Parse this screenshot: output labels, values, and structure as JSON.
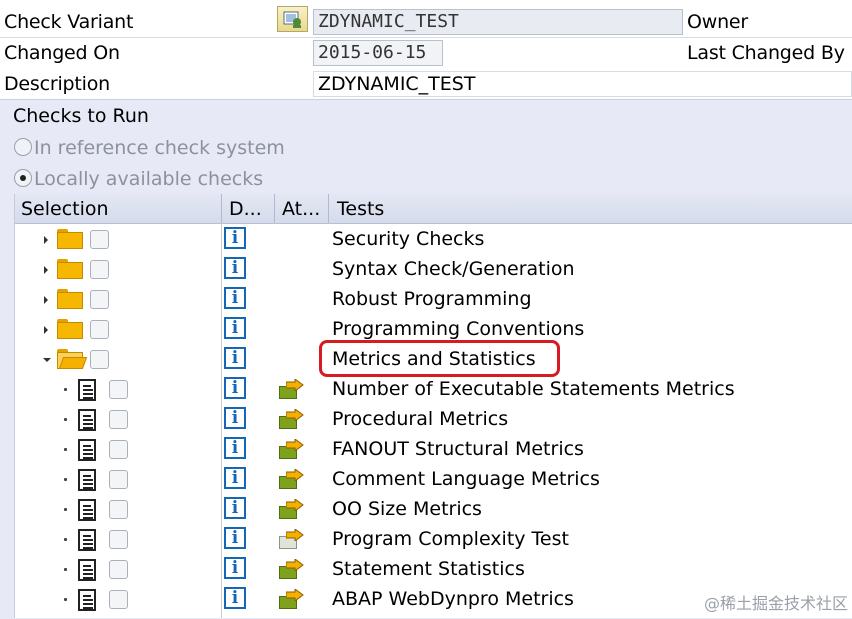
{
  "header": {
    "check_variant_label": "Check Variant",
    "check_variant_value": "ZDYNAMIC_TEST",
    "owner_label": "Owner",
    "changed_on_label": "Changed On",
    "changed_on_value": "2015-06-15",
    "last_changed_by_label": "Last Changed By",
    "description_label": "Description",
    "description_value": "ZDYNAMIC_TEST"
  },
  "group": {
    "title": "Checks to Run",
    "radio_reference": "In reference check system",
    "radio_local": "Locally available checks",
    "selected_radio": "Locally available checks"
  },
  "tree": {
    "columns": [
      "Selection",
      "D...",
      "At...",
      "Tests"
    ],
    "rows": [
      {
        "level": 0,
        "node": "folder",
        "expanded": false,
        "test": "Security Checks",
        "attribute_icon": ""
      },
      {
        "level": 0,
        "node": "folder",
        "expanded": false,
        "test": "Syntax Check/Generation",
        "attribute_icon": ""
      },
      {
        "level": 0,
        "node": "folder",
        "expanded": false,
        "test": "Robust Programming",
        "attribute_icon": ""
      },
      {
        "level": 0,
        "node": "folder",
        "expanded": false,
        "test": "Programming Conventions",
        "attribute_icon": ""
      },
      {
        "level": 0,
        "node": "folder",
        "expanded": true,
        "test": "Metrics and Statistics",
        "attribute_icon": "",
        "highlighted": true
      },
      {
        "level": 1,
        "node": "document",
        "test": "Number of Executable Statements Metrics",
        "attribute_icon": "attributes-arrow-icon"
      },
      {
        "level": 1,
        "node": "document",
        "test": "Procedural Metrics",
        "attribute_icon": "attributes-arrow-icon"
      },
      {
        "level": 1,
        "node": "document",
        "test": "FANOUT Structural Metrics",
        "attribute_icon": "attributes-arrow-icon"
      },
      {
        "level": 1,
        "node": "document",
        "test": "Comment Language Metrics",
        "attribute_icon": "attributes-arrow-icon"
      },
      {
        "level": 1,
        "node": "document",
        "test": "OO Size Metrics",
        "attribute_icon": "attributes-arrow-icon"
      },
      {
        "level": 1,
        "node": "document",
        "test": "Program Complexity Test",
        "attribute_icon": "attributes-empty-icon"
      },
      {
        "level": 1,
        "node": "document",
        "test": "Statement Statistics",
        "attribute_icon": "attributes-arrow-icon"
      },
      {
        "level": 1,
        "node": "document",
        "test": "ABAP WebDynpro Metrics",
        "attribute_icon": "attributes-arrow-icon"
      }
    ]
  },
  "watermark": "@稀土掘金技术社区",
  "colors": {
    "group_background": "#e7eaf6",
    "info_icon": "#1467b8",
    "highlight_border": "#d81b22",
    "folder": "#f6b700"
  }
}
